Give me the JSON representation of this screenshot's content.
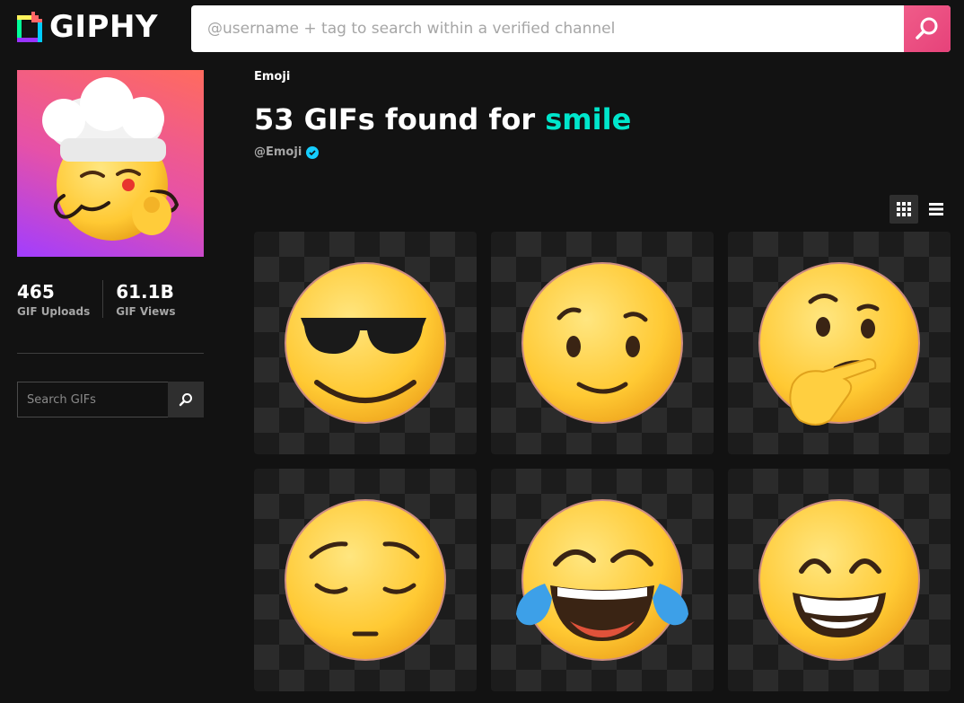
{
  "header": {
    "logo_text": "GIPHY",
    "search_placeholder": "@username + tag to search within a verified channel"
  },
  "sidebar": {
    "stats": [
      {
        "value": "465",
        "label": "GIF Uploads"
      },
      {
        "value": "61.1B",
        "label": "GIF Views"
      }
    ],
    "search_placeholder": "Search GIFs"
  },
  "main": {
    "channel_name": "Emoji",
    "headline_prefix": "53 GIFs found for ",
    "headline_term": "smile",
    "handle": "@Emoji"
  },
  "results": [
    {
      "emoji": "smiling-face-with-sunglasses"
    },
    {
      "emoji": "smiling-face"
    },
    {
      "emoji": "thinking-face"
    },
    {
      "emoji": "pensive-face"
    },
    {
      "emoji": "face-with-tears-of-joy"
    },
    {
      "emoji": "grinning-face-with-smiling-eyes"
    }
  ],
  "colors": {
    "background": "#121212",
    "accent_term": "#00e6cc",
    "search_button": "#e6427a",
    "verified_badge": "#15cdff"
  }
}
